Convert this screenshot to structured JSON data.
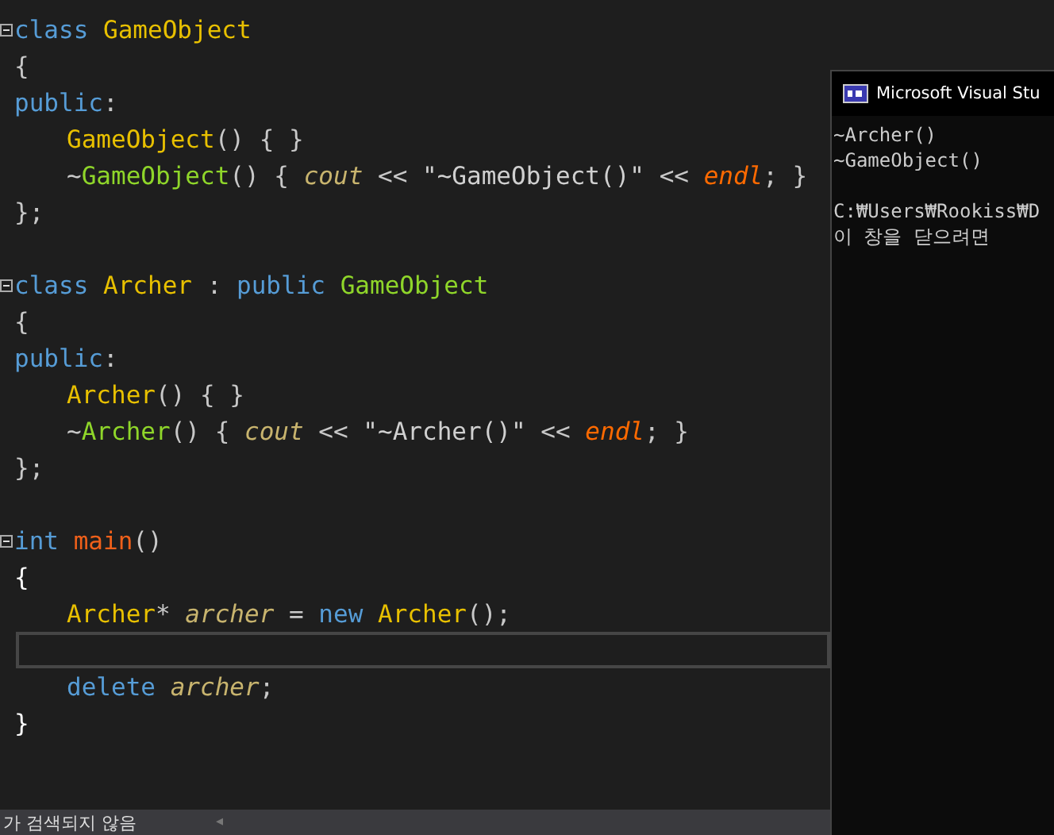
{
  "code_lines": [
    {
      "foldable": true,
      "current": false,
      "indented": false,
      "tokens": [
        {
          "text": "class ",
          "kind": "keyword"
        },
        {
          "text": "GameObject",
          "kind": "type"
        }
      ]
    },
    {
      "foldable": false,
      "current": false,
      "indented": false,
      "tokens": [
        {
          "text": "{",
          "kind": "plain"
        }
      ]
    },
    {
      "foldable": false,
      "current": false,
      "indented": false,
      "tokens": [
        {
          "text": "public",
          "kind": "keyword"
        },
        {
          "text": ":",
          "kind": "plain"
        }
      ]
    },
    {
      "foldable": false,
      "current": false,
      "indented": true,
      "tokens": [
        {
          "text": "GameObject",
          "kind": "type"
        },
        {
          "text": "() { }",
          "kind": "plain"
        }
      ]
    },
    {
      "foldable": false,
      "current": false,
      "indented": true,
      "tokens": [
        {
          "text": "~",
          "kind": "plain"
        },
        {
          "text": "GameObject",
          "kind": "dtor"
        },
        {
          "text": "() { ",
          "kind": "plain"
        },
        {
          "text": "cout",
          "kind": "stream"
        },
        {
          "text": " << ",
          "kind": "plain"
        },
        {
          "text": "\"~GameObject()\"",
          "kind": "string"
        },
        {
          "text": " << ",
          "kind": "plain"
        },
        {
          "text": "endl",
          "kind": "endl"
        },
        {
          "text": "; }",
          "kind": "plain"
        }
      ]
    },
    {
      "foldable": false,
      "current": false,
      "indented": false,
      "tokens": [
        {
          "text": "};",
          "kind": "plain"
        }
      ]
    },
    {
      "foldable": false,
      "current": false
    },
    {
      "foldable": true,
      "current": false,
      "indented": false,
      "tokens": [
        {
          "text": "class ",
          "kind": "keyword"
        },
        {
          "text": "Archer",
          "kind": "type"
        },
        {
          "text": " : ",
          "kind": "plain"
        },
        {
          "text": "public ",
          "kind": "keyword"
        },
        {
          "text": "GameObject",
          "kind": "dtor"
        }
      ]
    },
    {
      "foldable": false,
      "current": false,
      "indented": false,
      "tokens": [
        {
          "text": "{",
          "kind": "plain"
        }
      ]
    },
    {
      "foldable": false,
      "current": false,
      "indented": false,
      "tokens": [
        {
          "text": "public",
          "kind": "keyword"
        },
        {
          "text": ":",
          "kind": "plain"
        }
      ]
    },
    {
      "foldable": false,
      "current": false,
      "indented": true,
      "tokens": [
        {
          "text": "Archer",
          "kind": "type"
        },
        {
          "text": "() { }",
          "kind": "plain"
        }
      ]
    },
    {
      "foldable": false,
      "current": false,
      "indented": true,
      "tokens": [
        {
          "text": "~",
          "kind": "plain"
        },
        {
          "text": "Archer",
          "kind": "dtor"
        },
        {
          "text": "() { ",
          "kind": "plain"
        },
        {
          "text": "cout",
          "kind": "stream"
        },
        {
          "text": " << ",
          "kind": "plain"
        },
        {
          "text": "\"~Archer()\"",
          "kind": "string"
        },
        {
          "text": " << ",
          "kind": "plain"
        },
        {
          "text": "endl",
          "kind": "endl"
        },
        {
          "text": "; }",
          "kind": "plain"
        }
      ]
    },
    {
      "foldable": false,
      "current": false,
      "indented": false,
      "tokens": [
        {
          "text": "};",
          "kind": "plain"
        }
      ]
    },
    {
      "foldable": false,
      "current": false
    },
    {
      "foldable": true,
      "current": false,
      "indented": false,
      "tokens": [
        {
          "text": "int ",
          "kind": "keyword"
        },
        {
          "text": "main",
          "kind": "func"
        },
        {
          "text": "()",
          "kind": "plain"
        }
      ]
    },
    {
      "foldable": false,
      "current": false,
      "indented": false,
      "tokens": [
        {
          "text": "{",
          "kind": "brace"
        }
      ]
    },
    {
      "foldable": false,
      "current": false,
      "indented": true,
      "tokens": [
        {
          "text": "Archer",
          "kind": "type"
        },
        {
          "text": "* ",
          "kind": "plain"
        },
        {
          "text": "archer",
          "kind": "stream"
        },
        {
          "text": " = ",
          "kind": "plain"
        },
        {
          "text": "new ",
          "kind": "keyword"
        },
        {
          "text": "Archer",
          "kind": "type"
        },
        {
          "text": "();",
          "kind": "plain"
        }
      ]
    },
    {
      "foldable": false,
      "current": true
    },
    {
      "foldable": false,
      "current": false,
      "indented": true,
      "tokens": [
        {
          "text": "delete ",
          "kind": "keyword"
        },
        {
          "text": "archer",
          "kind": "stream"
        },
        {
          "text": ";",
          "kind": "plain"
        }
      ]
    },
    {
      "foldable": false,
      "current": false,
      "indented": false,
      "tokens": [
        {
          "text": "}",
          "kind": "brace"
        }
      ]
    }
  ],
  "console": {
    "title": "Microsoft Visual Stu",
    "output": [
      "~Archer()",
      "~GameObject()"
    ],
    "footer": [
      "C:₩Users₩Rookiss₩D",
      "이 창을 닫으려면"
    ]
  },
  "status_bar": {
    "text": "가 검색되지 않음",
    "scroll_arrow": "◂"
  }
}
